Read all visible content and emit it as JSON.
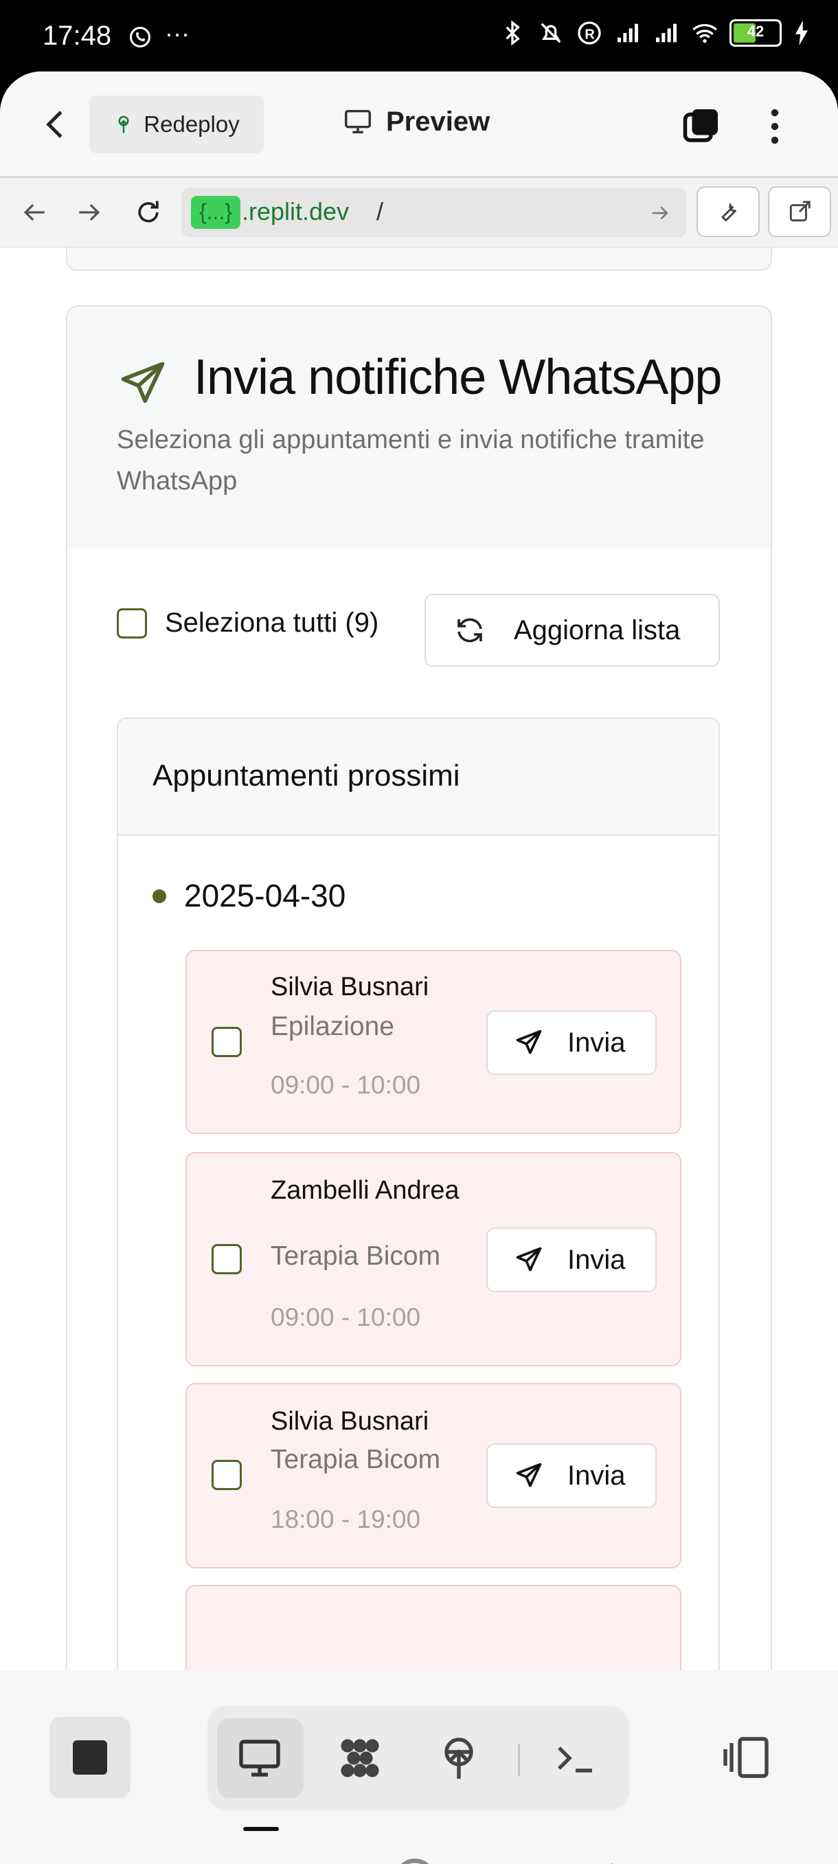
{
  "status_bar": {
    "time": "17:48",
    "battery": "42",
    "icons": [
      "whatsapp-icon",
      "more-dots-icon",
      "bluetooth-icon",
      "bell-off-icon",
      "registered-icon",
      "signal-icon",
      "signal-icon",
      "wifi-icon",
      "battery-icon",
      "charging-icon"
    ]
  },
  "topbar": {
    "redeploy_label": "Redeploy",
    "preview_label": "Preview"
  },
  "urlbar": {
    "chip": "{...}",
    "host": ".replit.dev",
    "path": "/"
  },
  "card": {
    "title": "Invia notifiche WhatsApp",
    "subtitle": "Seleziona gli appuntamenti e invia notifiche tramite WhatsApp",
    "select_all_label": "Seleziona tutti (9)",
    "refresh_label": "Aggiorna lista",
    "section_title": "Appuntamenti prossimi",
    "date": "2025-04-30",
    "appointments": [
      {
        "name": "Silvia Busnari",
        "service": "Epilazione",
        "time": "09:00 - 10:00",
        "button": "Invia"
      },
      {
        "name": "Zambelli Andrea",
        "service": "Terapia Bicom",
        "time": "09:00 - 10:00",
        "button": "Invia"
      },
      {
        "name": "Silvia Busnari",
        "service": "Terapia Bicom",
        "time": "18:00 - 19:00",
        "button": "Invia"
      }
    ]
  },
  "colors": {
    "accent": "#52652a",
    "appointment_bg": "#fdf0f0",
    "url_chip": "#3ecf5b"
  }
}
